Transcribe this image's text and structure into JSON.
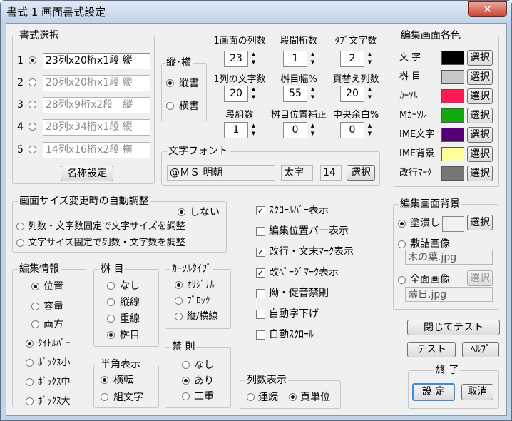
{
  "window": {
    "title": "書式 1  画面書式設定",
    "close_glyph": "✕"
  },
  "format_select": {
    "label": "書式選択",
    "items": [
      {
        "num": "1",
        "value": "23列x20桁x1段 縦",
        "checked": true,
        "enabled": true
      },
      {
        "num": "2",
        "value": "20列x20桁x1段 縦",
        "checked": false,
        "enabled": false
      },
      {
        "num": "3",
        "value": "28列x9桁x2段　縦",
        "checked": false,
        "enabled": false
      },
      {
        "num": "4",
        "value": "28列x34桁x1段 縦",
        "checked": false,
        "enabled": false
      },
      {
        "num": "5",
        "value": "14列x16桁x2段 横",
        "checked": false,
        "enabled": false
      }
    ],
    "name_button": "名称設定"
  },
  "orientation": {
    "label": "縦･横",
    "vertical": "縦書",
    "horizontal": "横書",
    "selected": "vertical"
  },
  "layout": {
    "fields": [
      {
        "label": "1画面の列数",
        "value": "23"
      },
      {
        "label": "段間桁数",
        "value": "1"
      },
      {
        "label": "ﾀﾌﾞ文字数",
        "value": "2"
      },
      {
        "label": "1列の文字数",
        "value": "20"
      },
      {
        "label": "桝目幅%",
        "value": "55"
      },
      {
        "label": "頁替え列数",
        "value": "20"
      },
      {
        "label": "段組数",
        "value": "1"
      },
      {
        "label": "桝目位置補正",
        "value": "0"
      },
      {
        "label": "中央余白%",
        "value": "0"
      }
    ],
    "spin_up": "▲",
    "spin_down": "▼"
  },
  "font": {
    "label": "文字フォント",
    "name": "@ＭＳ 明朝",
    "style": "太字",
    "size": "14",
    "select": "選択"
  },
  "colors": {
    "label": "編集画面各色",
    "select": "選択",
    "items": [
      {
        "name": "文 字",
        "color": "#000000"
      },
      {
        "name": "桝 目",
        "color": "#c8c8c8"
      },
      {
        "name": "ｶｰｿﾙ",
        "color": "#ff1a55"
      },
      {
        "name": "Mｶｰｿﾙ",
        "color": "#11aa11"
      },
      {
        "name": "IME文字",
        "color": "#550077"
      },
      {
        "name": "IME背景",
        "color": "#ffff99"
      },
      {
        "name": "改行ﾏｰｸ",
        "color": "#777777"
      }
    ]
  },
  "auto_adjust": {
    "label": "画面サイズ変更時の自動調整",
    "none": "しない",
    "opt1": "列数・文字数固定で文字サイズを調整",
    "opt2": "文字サイズ固定で列数・文字数を調整"
  },
  "toggles": [
    {
      "label": "ｽｸﾛｰﾙﾊﾞｰ表示",
      "checked": true
    },
    {
      "label": "編集位置バー表示",
      "checked": false
    },
    {
      "label": "改行・文末ﾏｰｸ表示",
      "checked": true
    },
    {
      "label": "改ﾍﾟｰｼﾞﾏｰｸ表示",
      "checked": true
    },
    {
      "label": "拗・促音禁則",
      "checked": false
    },
    {
      "label": "自動字下げ",
      "checked": false
    },
    {
      "label": "自動ｽｸﾛｰﾙ",
      "checked": false
    }
  ],
  "check_mark": "✓",
  "background": {
    "label": "編集画面背景",
    "fill": "塗潰し",
    "tile": "敷詰画像",
    "tile_file": "木の葉.jpg",
    "full": "全面画像",
    "full_file": "薄日.jpg",
    "select": "選択",
    "fill_color": "#f5f5f5"
  },
  "edit_info": {
    "label": "編集情報",
    "opts": [
      "位置",
      "容量",
      "両方"
    ],
    "selected": 0,
    "box_opts": [
      "ﾀｲﾄﾙﾊﾞｰ",
      "ﾎﾞｯｸｽ小",
      "ﾎﾞｯｸｽ中",
      "ﾎﾞｯｸｽ大"
    ],
    "box_selected": 0
  },
  "masume": {
    "label": "桝 目",
    "opts": [
      "なし",
      "縦線",
      "重線",
      "桝目"
    ],
    "selected": 3
  },
  "cursor_type": {
    "label": "ｶｰｿﾙﾀｲﾌﾟ",
    "opts": [
      "ｵﾘｼﾞﾅﾙ",
      "ﾌﾞﾛｯｸ",
      "縦/横線"
    ],
    "selected": 0
  },
  "hankaku": {
    "label": "半角表示",
    "opts": [
      "横転",
      "組文字"
    ],
    "selected": 0
  },
  "kinsoku": {
    "label": "禁 則",
    "opts": [
      "なし",
      "あり",
      "二重"
    ],
    "selected": 1
  },
  "col_display": {
    "label": "列数表示",
    "opts": [
      "連続",
      "頁単位"
    ],
    "selected": 1
  },
  "actions": {
    "close_test": "閉じてテスト",
    "test": "テスト",
    "help": "ﾍﾙﾌﾟ",
    "end_label": "終 了",
    "ok": "設 定",
    "cancel": "取消"
  }
}
